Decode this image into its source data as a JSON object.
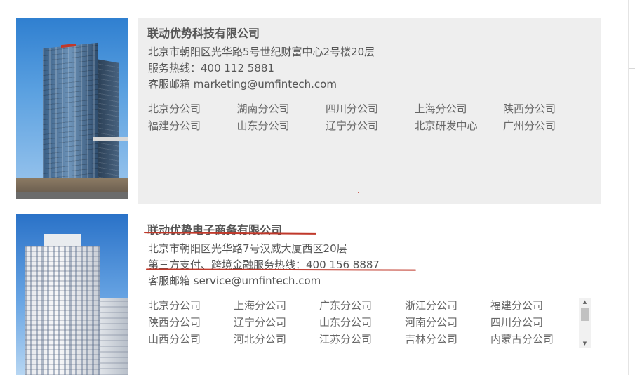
{
  "companies": [
    {
      "name": "联动优势科技有限公司",
      "address": "北京市朝阳区光华路5号世纪财富中心2号楼20层",
      "hotline": "服务热线：400 112 5881",
      "email": "客服邮箱 marketing@umfintech.com",
      "photo_icon": "office-tower-photo",
      "branches": [
        [
          "北京分公司",
          "湖南分公司",
          "四川分公司",
          "上海分公司",
          "陕西分公司"
        ],
        [
          "福建分公司",
          "山东分公司",
          "辽宁分公司",
          "北京研发中心",
          "广州分公司"
        ]
      ]
    },
    {
      "name": "联动优势电子商务有限公司",
      "address": "北京市朝阳区光华路7号汉威大厦西区20层",
      "hotline": "第三方支付、跨境金融服务热线：400 156 8887",
      "email": "客服邮箱 service@umfintech.com",
      "photo_icon": "hanwei-building-photo",
      "branches": [
        [
          "北京分公司",
          "上海分公司",
          "广东分公司",
          "浙江分公司",
          "福建分公司"
        ],
        [
          "陕西分公司",
          "辽宁分公司",
          "山东分公司",
          "河南分公司",
          "四川分公司"
        ],
        [
          "山西分公司",
          "河北分公司",
          "江苏分公司",
          "吉林分公司",
          "内蒙古分公司"
        ]
      ]
    }
  ],
  "colors": {
    "card_background": "#eeeeee",
    "text": "#555555",
    "annotation_mark": "#c0392b"
  },
  "scrollbar_icons": [
    "scroll-up-arrow-icon",
    "scroll-down-arrow-icon"
  ]
}
